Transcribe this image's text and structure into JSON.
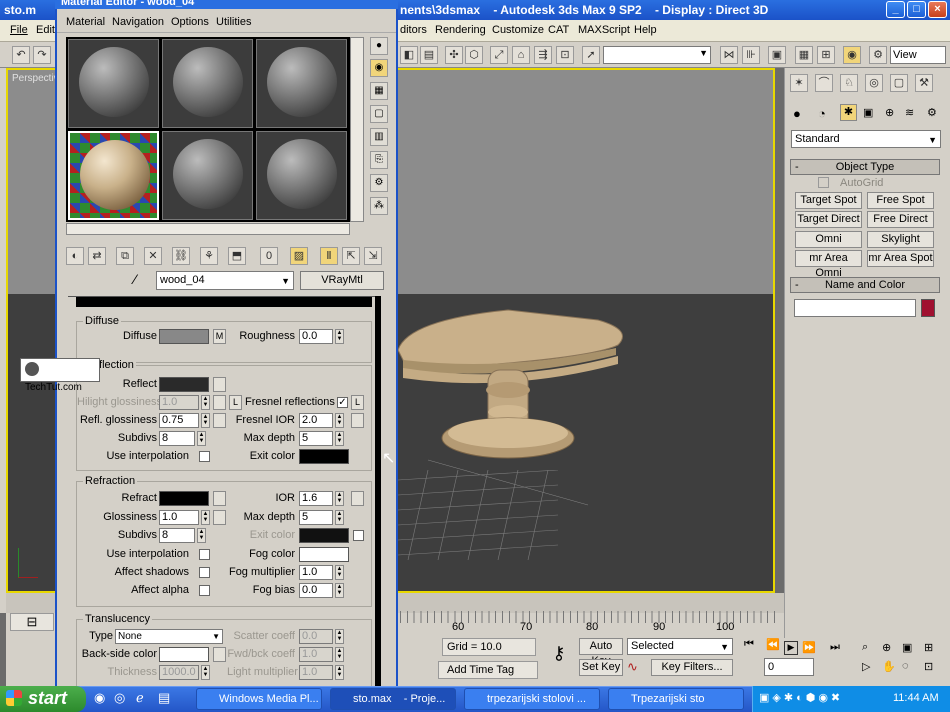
{
  "app": {
    "title": "nents\\3dsmax    - Autodesk 3ds Max 9 SP2    - Display : Direct 3D",
    "title_left": "sto.m",
    "menus": [
      "File",
      "Edit",
      "ditors",
      "Rendering",
      "Customize",
      "CAT",
      "MAXScript",
      "Help"
    ],
    "view_dropdown": "View"
  },
  "viewport": {
    "label": "Perspectiv",
    "ruler_ticks": [
      "60",
      "70",
      "80",
      "90",
      "100"
    ]
  },
  "material_editor": {
    "title": "Material Editor - wood_04",
    "menus": [
      "Material",
      "Navigation",
      "Options",
      "Utilities"
    ],
    "material_name": "wood_04",
    "material_type": "VRayMtl",
    "diffuse": {
      "group": "Diffuse",
      "diffuse_label": "Diffuse",
      "m_btn": "M",
      "roughness_label": "Roughness",
      "roughness": "0.0"
    },
    "reflection": {
      "group": "Reflection",
      "reflect_label": "Reflect",
      "hilight_label": "Hilight glossiness",
      "hilight": "1.0",
      "l_btn": "L",
      "fresnel_label": "Fresnel reflections",
      "fresnel_checked": "✓",
      "refl_gloss_label": "Refl. glossiness",
      "refl_gloss": "0.75",
      "fresnel_ior_label": "Fresnel IOR",
      "fresnel_ior": "2.0",
      "subdivs_label": "Subdivs",
      "subdivs": "8",
      "max_depth_label": "Max depth",
      "max_depth": "5",
      "use_interp_label": "Use interpolation",
      "exit_color_label": "Exit color"
    },
    "refraction": {
      "group": "Refraction",
      "refract_label": "Refract",
      "ior_label": "IOR",
      "ior": "1.6",
      "glossiness_label": "Glossiness",
      "glossiness": "1.0",
      "max_depth_label": "Max depth",
      "max_depth": "5",
      "subdivs_label": "Subdivs",
      "subdivs": "8",
      "exit_color_label": "Exit color",
      "use_interp_label": "Use interpolation",
      "fog_color_label": "Fog color",
      "affect_shadows_label": "Affect shadows",
      "fog_mult_label": "Fog multiplier",
      "fog_mult": "1.0",
      "affect_alpha_label": "Affect alpha",
      "fog_bias_label": "Fog bias",
      "fog_bias": "0.0"
    },
    "translucency": {
      "group": "Translucency",
      "type_label": "Type",
      "type_value": "None",
      "scatter_label": "Scatter coeff",
      "scatter": "0.0",
      "backside_label": "Back-side color",
      "fwd_label": "Fwd/bck coeff",
      "fwd": "1.0",
      "thickness_label": "Thickness",
      "thickness": "1000.0",
      "light_mult_label": "Light multiplier",
      "light_mult": "1.0"
    }
  },
  "watermark": "TechTut.com",
  "command_panel": {
    "dropdown": "Standard",
    "object_type_header": "Object Type",
    "autogrid_label": "AutoGrid",
    "buttons": [
      "Target Spot",
      "Free Spot",
      "Target Direct",
      "Free Direct",
      "Omni",
      "Skylight",
      "mr Area Omni",
      "mr Area Spot"
    ],
    "name_color_header": "Name and Color",
    "accent": "#a01030"
  },
  "bottom_bar": {
    "grid": "Grid = 10.0",
    "auto_key": "Auto Key",
    "selected": "Selected",
    "set_key": "Set Key",
    "key_filters": "Key Filters...",
    "add_time_tag": "Add Time Tag",
    "frame": "0"
  },
  "taskbar": {
    "start": "start",
    "tasks": [
      "Windows Media Pl...",
      "sto.max    - Proje...",
      "trpezarijski stolovi ...",
      "Trpezarijski sto"
    ],
    "clock": "11:44 AM"
  }
}
